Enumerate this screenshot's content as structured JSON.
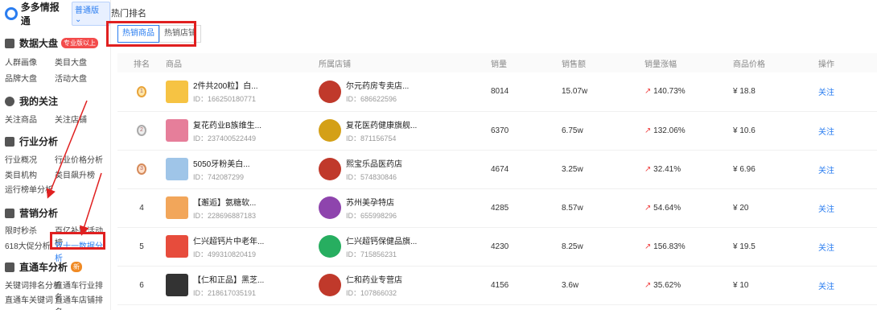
{
  "brand": {
    "name": "多多情报通",
    "badge": "普通版 ⌄"
  },
  "sidebar": {
    "sections": [
      {
        "title": "数据大盘",
        "pill": "专业版以上",
        "icon": "grid-icon",
        "items": [
          "人群画像",
          "类目大盘",
          "品牌大盘",
          "活动大盘"
        ]
      },
      {
        "title": "我的关注",
        "icon": "star-icon",
        "items": [
          "关注商品",
          "关注店铺"
        ]
      },
      {
        "title": "行业分析",
        "icon": "chart-icon",
        "items": [
          "行业概况",
          "行业价格分析",
          "类目机构",
          "类目飙升榜",
          "运行榜单分析"
        ]
      },
      {
        "title": "营销分析",
        "icon": "megaphone-icon",
        "items": [
          "限时秒杀",
          "百亿补贴活动榜",
          "618大促分析",
          "双十一数据分析"
        ]
      },
      {
        "title": "直通车分析",
        "pill": "新",
        "icon": "car-icon",
        "items": [
          "关键词排名分析",
          "直通车行业排名",
          "直通车关键词",
          "直通车店铺排名"
        ]
      }
    ]
  },
  "main": {
    "title": "热门排名",
    "tabs": [
      "热销商品",
      "热销店铺"
    ],
    "columns": [
      "排名",
      "商品",
      "所属店铺",
      "销量",
      "销售额",
      "销量涨幅",
      "商品价格",
      "操作"
    ],
    "rows": [
      {
        "rank": "1",
        "medal": "gold",
        "name": "2件共200粒】白...",
        "id": "ID：166250180771",
        "shop": "尔元药房专卖店...",
        "shop_id": "ID：686622596",
        "sales": "8014",
        "amount": "15.07w",
        "growth": "140.73%",
        "price": "¥ 18.8",
        "op": "关注",
        "thumb": "#f6c343",
        "shoplogo": "#c0392b"
      },
      {
        "rank": "2",
        "medal": "silver",
        "name": "复花药业B族维生...",
        "id": "ID：237400522449",
        "shop": "复花医药健康旗舰...",
        "shop_id": "ID：871156754",
        "sales": "6370",
        "amount": "6.75w",
        "growth": "132.06%",
        "price": "¥ 10.6",
        "op": "关注",
        "thumb": "#e67e9a",
        "shoplogo": "#d4a017"
      },
      {
        "rank": "3",
        "medal": "bronze",
        "name": "5050牙粉美白...",
        "id": "ID：742087299",
        "shop": "熙宝乐品医药店",
        "shop_id": "ID：574830846",
        "sales": "4674",
        "amount": "3.25w",
        "growth": "32.41%",
        "price": "¥ 6.96",
        "op": "关注",
        "thumb": "#9fc5e8",
        "shoplogo": "#c0392b"
      },
      {
        "rank": "4",
        "medal": "",
        "name": "【邂逅】氨糖软...",
        "id": "ID：228696887183",
        "shop": "苏州美孕特店",
        "shop_id": "ID：655998296",
        "sales": "4285",
        "amount": "8.57w",
        "growth": "54.64%",
        "price": "¥ 20",
        "op": "关注",
        "thumb": "#f2a65a",
        "shoplogo": "#8e44ad"
      },
      {
        "rank": "5",
        "medal": "",
        "name": "仁兴超钙片中老年...",
        "id": "ID：499310820419",
        "shop": "仁兴超钙保健品旗...",
        "shop_id": "ID：715856231",
        "sales": "4230",
        "amount": "8.25w",
        "growth": "156.83%",
        "price": "¥ 19.5",
        "op": "关注",
        "thumb": "#e74c3c",
        "shoplogo": "#27ae60"
      },
      {
        "rank": "6",
        "medal": "",
        "name": "【仁和正品】黑芝...",
        "id": "ID：218617035191",
        "shop": "仁和药业专营店",
        "shop_id": "ID：107866032",
        "sales": "4156",
        "amount": "3.6w",
        "growth": "35.62%",
        "price": "¥ 10",
        "op": "关注",
        "thumb": "#333333",
        "shoplogo": "#c0392b"
      }
    ]
  }
}
